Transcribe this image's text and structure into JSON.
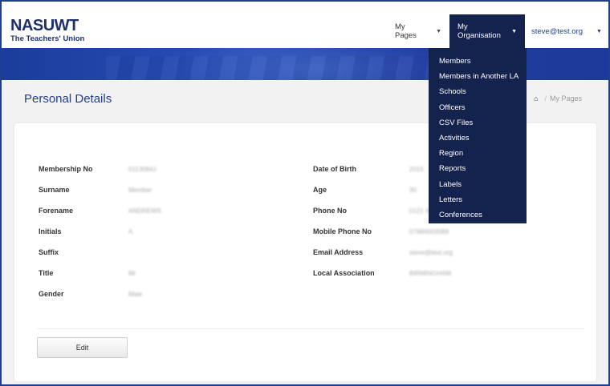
{
  "header": {
    "logo_main": "NASUWT",
    "logo_sub": "The Teachers' Union",
    "nav": {
      "my_pages": "My Pages",
      "my_organisation": "My Organisation",
      "user_email": "steve@test.org"
    }
  },
  "page": {
    "title": "Personal Details",
    "breadcrumb_current": "My Pages"
  },
  "dropdown": {
    "items": [
      "Members",
      "Members in Another LA",
      "Schools",
      "Officers",
      "CSV Files",
      "Activities",
      "Region",
      "Reports",
      "Labels",
      "Letters",
      "Conferences"
    ]
  },
  "details": {
    "left": [
      {
        "label": "Membership No",
        "value": "0113084J"
      },
      {
        "label": "Surname",
        "value": "Member"
      },
      {
        "label": "Forename",
        "value": "ANDREWS"
      },
      {
        "label": "Initials",
        "value": "A"
      },
      {
        "label": "Suffix",
        "value": ""
      },
      {
        "label": "Title",
        "value": "Mr"
      },
      {
        "label": "Gender",
        "value": "Male"
      }
    ],
    "right": [
      {
        "label": "Date of Birth",
        "value": "2015"
      },
      {
        "label": "Age",
        "value": "30"
      },
      {
        "label": "Phone No",
        "value": "0121 4"
      },
      {
        "label": "Mobile Phone No",
        "value": "07984003089"
      },
      {
        "label": "Email Address",
        "value": "steve@test.org"
      },
      {
        "label": "Local Association",
        "value": "BIRMINGHAM"
      }
    ]
  },
  "actions": {
    "edit_label": "Edit"
  }
}
